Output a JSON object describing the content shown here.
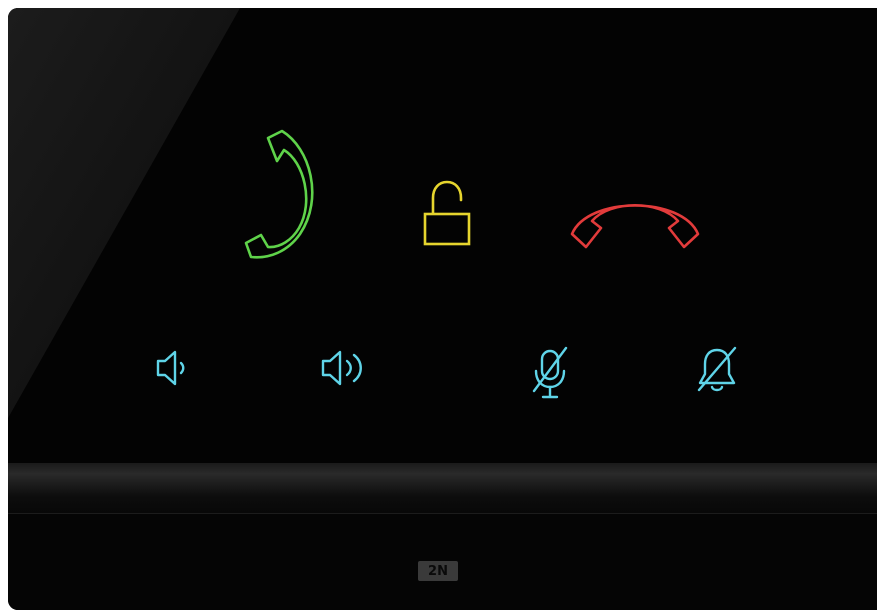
{
  "device": {
    "brand_logo": "2N"
  },
  "controls": {
    "answer_call": {
      "icon": "phone-answer-icon",
      "color": "#5fd34a"
    },
    "unlock_door": {
      "icon": "unlock-icon",
      "color": "#e6d52e"
    },
    "hang_up": {
      "icon": "phone-hangup-icon",
      "color": "#e23b3b"
    },
    "volume_down": {
      "icon": "volume-low-icon",
      "color": "#5fd4e8"
    },
    "volume_up": {
      "icon": "volume-high-icon",
      "color": "#5fd4e8"
    },
    "mute_microphone": {
      "icon": "microphone-off-icon",
      "color": "#5fd4e8"
    },
    "mute_ringtone": {
      "icon": "bell-off-icon",
      "color": "#5fd4e8"
    }
  }
}
